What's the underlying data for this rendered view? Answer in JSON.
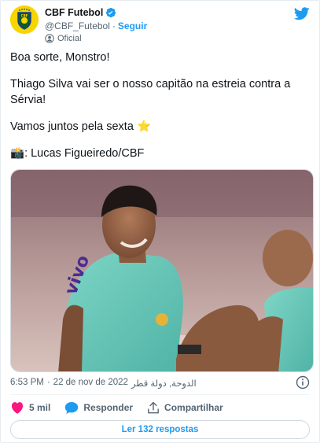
{
  "author": {
    "display_name": "CBF Futebol",
    "handle": "@CBF_Futebol",
    "separator": "·",
    "follow_label": "Seguir",
    "label": "Oficial"
  },
  "tweet": {
    "line1": "Boa sorte, Monstro!",
    "line2": "Thiago Silva vai ser o nosso capitão na estreia contra a Sérvia!",
    "line3": "Vamos juntos pela sexta",
    "line4": ": Lucas Figueiredo/CBF",
    "emoji_star": "⭐",
    "emoji_camera": "📸"
  },
  "timestamp": {
    "time": "6:53 PM",
    "separator": "·",
    "date": "22 de nov de 2022",
    "location": "الدوحة, دولة قطر"
  },
  "actions": {
    "like_count": "5 mil",
    "reply_label": "Responder",
    "share_label": "Compartilhar"
  },
  "replies_button": "Ler 132 respostas",
  "colors": {
    "accent": "#1d9bf0",
    "like": "#f91880",
    "avatar_bg": "#f7d500"
  }
}
